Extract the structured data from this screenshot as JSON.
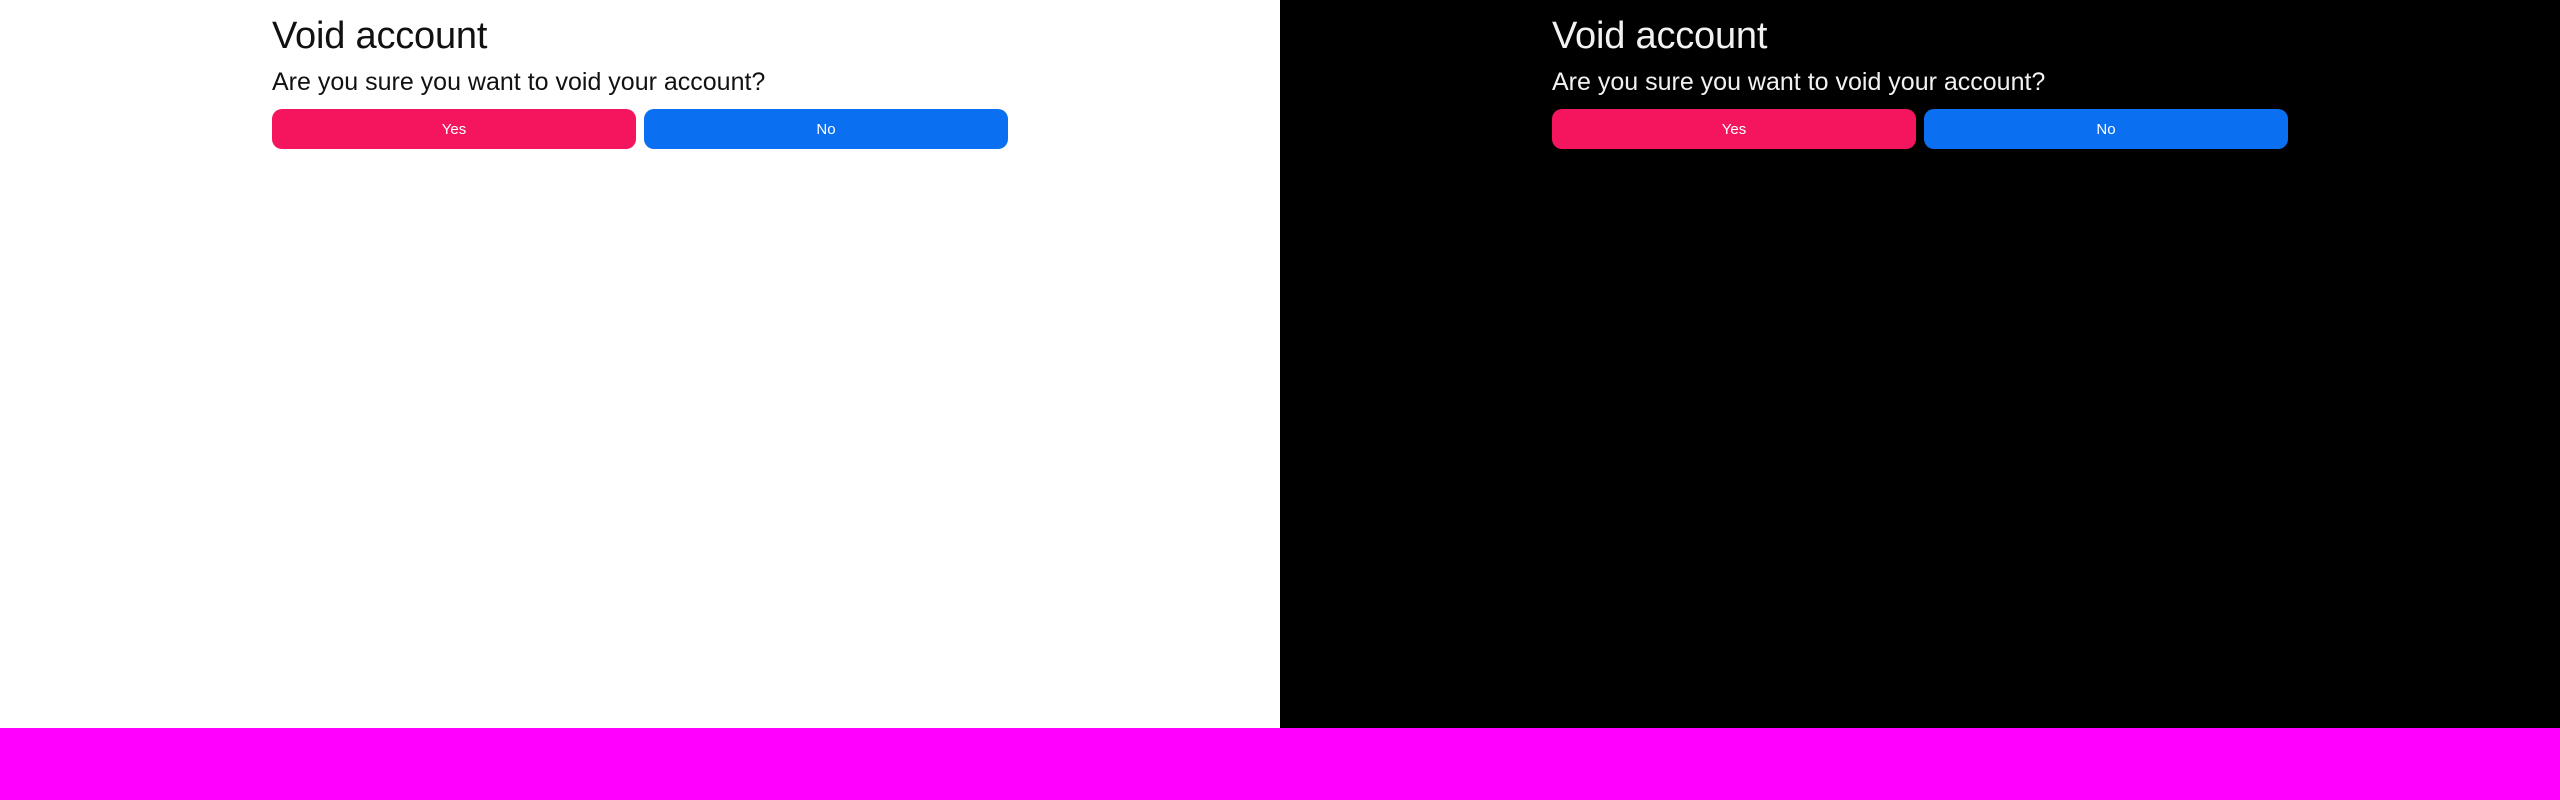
{
  "colors": {
    "light_bg": "#ffffff",
    "dark_bg": "#000000",
    "yes_button": "#f5155f",
    "no_button": "#0a6ff0",
    "bottom_strip": "#ff00ff"
  },
  "light": {
    "title": "Void account",
    "question": "Are you sure you want to void your account?",
    "yes_label": "Yes",
    "no_label": "No"
  },
  "dark": {
    "title": "Void account",
    "question": "Are you sure you want to void your account?",
    "yes_label": "Yes",
    "no_label": "No"
  }
}
